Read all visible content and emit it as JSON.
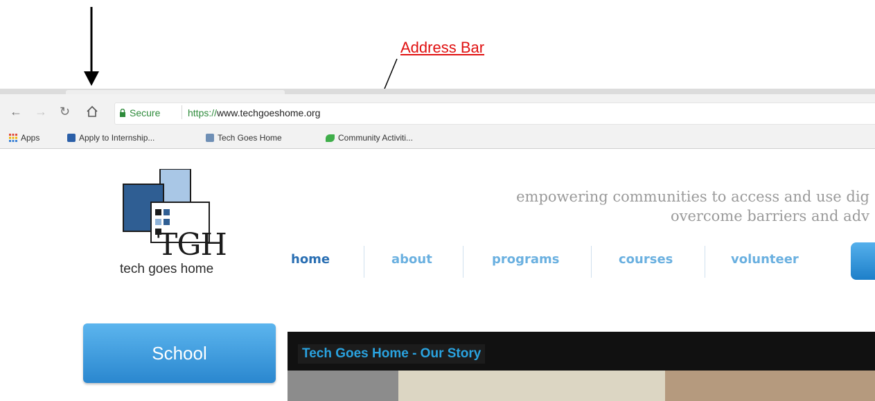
{
  "annotation": {
    "label": "Address Bar"
  },
  "toolbar": {
    "secure_label": "Secure",
    "url_scheme": "https://",
    "url_host": "www.techgoeshome.org"
  },
  "bookmarks": [
    {
      "label": "Apps",
      "icon": "apps-grid-icon"
    },
    {
      "label": "Apply to Internship...",
      "icon": "bookmark-favicon"
    },
    {
      "label": "Tech Goes Home",
      "icon": "bookmark-favicon"
    },
    {
      "label": "Community Activiti...",
      "icon": "leaf-favicon"
    }
  ],
  "site": {
    "logo": {
      "abbrev": "TGH",
      "name": "tech goes home"
    },
    "tagline": [
      "empowering communities to access and use dig",
      "overcome barriers and adv"
    ],
    "nav": [
      "home",
      "about",
      "programs",
      "courses",
      "volunteer"
    ],
    "sidebar_button": "School",
    "video_title": "Tech Goes Home - Our Story"
  },
  "colors": {
    "annotation": "#e01010",
    "nav_active": "#2a6fb3",
    "nav": "#6ab0e0",
    "secure": "#2e8b3b"
  }
}
